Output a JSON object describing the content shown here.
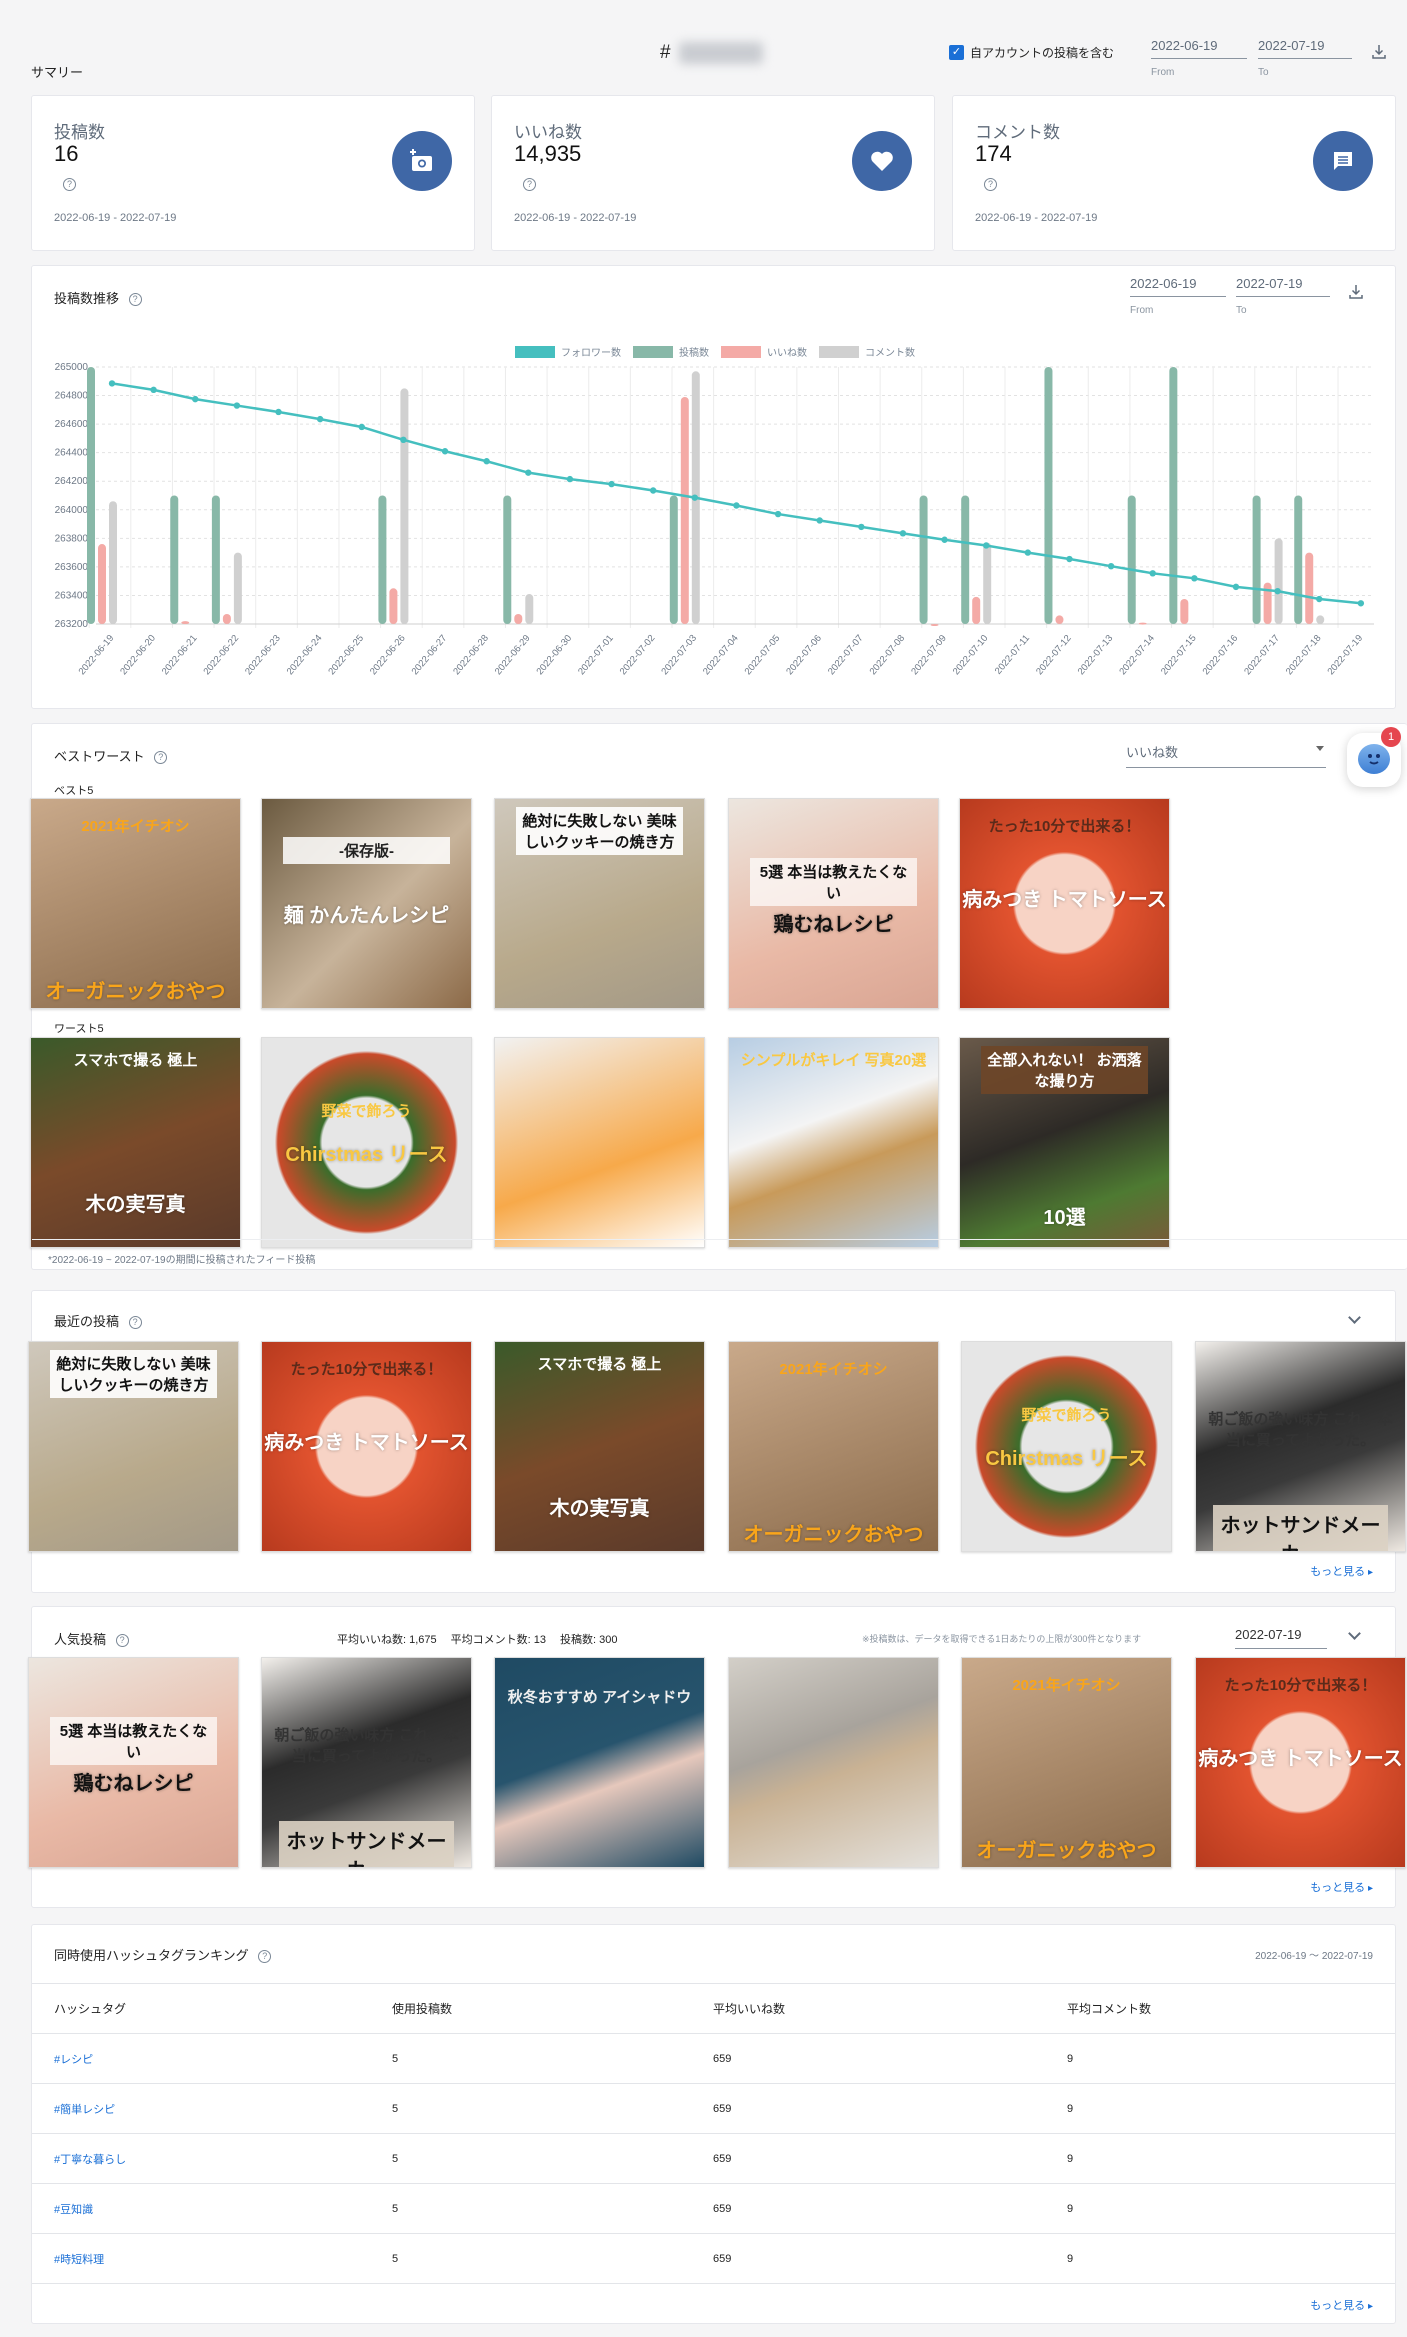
{
  "header": {
    "summary_label": "サマリー",
    "hashtag_prefix": "#",
    "include_own_label": "自アカウントの投稿を含む",
    "include_own_checked": true,
    "from_date": "2022-06-19",
    "to_date": "2022-07-19",
    "from_label": "From",
    "to_label": "To"
  },
  "stats": [
    {
      "title": "投稿数",
      "value": "16",
      "range": "2022-06-19 - 2022-07-19",
      "icon": "add-photo-icon"
    },
    {
      "title": "いいね数",
      "value": "14,935",
      "range": "2022-06-19 - 2022-07-19",
      "icon": "heart-icon"
    },
    {
      "title": "コメント数",
      "value": "174",
      "range": "2022-06-19 - 2022-07-19",
      "icon": "comment-icon"
    }
  ],
  "chart_section": {
    "title": "投稿数推移",
    "from_date": "2022-06-19",
    "to_date": "2022-07-19",
    "from_label": "From",
    "to_label": "To"
  },
  "chart_data": {
    "type": "bar",
    "title": "投稿数推移",
    "xlabel": "",
    "ylabel": "",
    "ylim": [
      263200,
      265000
    ],
    "yticks": [
      265000,
      264800,
      264600,
      264400,
      264200,
      264000,
      263800,
      263600,
      263400,
      263200
    ],
    "grid": true,
    "legend_position": "top-center",
    "categories": [
      "2022-06-19",
      "2022-06-20",
      "2022-06-21",
      "2022-06-22",
      "2022-06-23",
      "2022-06-24",
      "2022-06-25",
      "2022-06-26",
      "2022-06-27",
      "2022-06-28",
      "2022-06-29",
      "2022-06-30",
      "2022-07-01",
      "2022-07-02",
      "2022-07-03",
      "2022-07-04",
      "2022-07-05",
      "2022-07-06",
      "2022-07-07",
      "2022-07-08",
      "2022-07-09",
      "2022-07-10",
      "2022-07-11",
      "2022-07-12",
      "2022-07-13",
      "2022-07-14",
      "2022-07-15",
      "2022-07-16",
      "2022-07-17",
      "2022-07-18",
      "2022-07-19"
    ],
    "series": [
      {
        "name": "フォロワー数",
        "kind": "line",
        "color": "#45bfbf",
        "values": [
          264885,
          264840,
          264775,
          264730,
          264685,
          264635,
          264580,
          264490,
          264410,
          264340,
          264260,
          264215,
          264180,
          264135,
          264085,
          264030,
          263970,
          263925,
          263880,
          263835,
          263790,
          263750,
          263700,
          263655,
          263605,
          263555,
          263520,
          263460,
          263430,
          263375,
          263345
        ]
      },
      {
        "name": "投稿数",
        "kind": "bar",
        "color": "#88b8a8",
        "values": [
          265000,
          null,
          264100,
          264100,
          null,
          null,
          null,
          264100,
          null,
          null,
          264100,
          null,
          null,
          null,
          264100,
          null,
          null,
          null,
          null,
          null,
          264100,
          264100,
          null,
          265000,
          null,
          264100,
          265000,
          null,
          264100,
          264100,
          null
        ]
      },
      {
        "name": "いいね数",
        "kind": "bar",
        "color": "#f4aaa6",
        "values": [
          263760,
          null,
          263220,
          263270,
          null,
          null,
          null,
          263450,
          null,
          null,
          263270,
          null,
          null,
          null,
          264790,
          null,
          null,
          null,
          null,
          null,
          263200,
          263390,
          null,
          263260,
          null,
          263210,
          263375,
          null,
          263490,
          263700,
          null
        ]
      },
      {
        "name": "コメント数",
        "kind": "bar",
        "color": "#d0d0d0",
        "values": [
          264060,
          null,
          null,
          263700,
          null,
          null,
          null,
          264850,
          null,
          null,
          263410,
          null,
          null,
          null,
          264970,
          null,
          null,
          null,
          null,
          null,
          null,
          263770,
          null,
          null,
          null,
          null,
          null,
          null,
          263800,
          263260,
          null
        ]
      }
    ]
  },
  "best_worst": {
    "title": "ベストワースト",
    "metric_select": "いいね数",
    "best_label": "ベスト5",
    "worst_label": "ワースト5",
    "footnote": "*2022-06-19 ~ 2022-07-19の期間に投稿されたフィード投稿",
    "best": [
      {
        "caption": "2021年イチオシ",
        "sub": "オーガニックおやつ",
        "theme": "puffs"
      },
      {
        "caption": "-保存版-",
        "sub": "麺 かんたんレシピ",
        "theme": "noodle"
      },
      {
        "caption": "絶対に失敗しない 美味しいクッキーの焼き方",
        "sub": "",
        "theme": "cookie"
      },
      {
        "caption": "5選 本当は教えたくない",
        "sub": "鶏むねレシピ",
        "theme": "chicken"
      },
      {
        "caption": "たった10分で出来る！",
        "sub": "病みつき トマトソース",
        "theme": "tomato"
      }
    ],
    "worst": [
      {
        "caption": "スマホで撮る 極上",
        "sub": "木の実写真",
        "theme": "nuts"
      },
      {
        "caption": "野菜で飾ろう",
        "sub": "Chirstmas リース",
        "theme": "wreath"
      },
      {
        "caption": "",
        "sub": "",
        "theme": "phone-food"
      },
      {
        "caption": "シンプルがキレイ 写真20選",
        "sub": "",
        "theme": "roast"
      },
      {
        "caption": "全部入れない！ お洒落な撮り方",
        "sub": "10選",
        "theme": "burger"
      }
    ]
  },
  "recent": {
    "title": "最近の投稿",
    "more_label": "もっと見る",
    "posts": [
      {
        "caption": "絶対に失敗しない 美味しいクッキーの焼き方",
        "sub": "",
        "theme": "cookie"
      },
      {
        "caption": "たった10分で出来る！",
        "sub": "病みつき トマトソース",
        "theme": "tomato"
      },
      {
        "caption": "スマホで撮る 極上",
        "sub": "木の実写真",
        "theme": "nuts"
      },
      {
        "caption": "2021年イチオシ",
        "sub": "オーガニックおやつ",
        "theme": "puffs"
      },
      {
        "caption": "野菜で飾ろう",
        "sub": "Chirstmas リース",
        "theme": "wreath"
      },
      {
        "caption": "朝ご飯の強い味方 これ、本当に買ってよかった。",
        "sub": "ホットサンドメーカー",
        "theme": "hotsand"
      }
    ]
  },
  "popular": {
    "title": "人気投稿",
    "avg_likes": "平均いいね数: 1,675",
    "avg_comments": "平均コメント数: 13",
    "post_count": "投稿数: 300",
    "note": "※投稿数は、データを取得できる1日あたりの上限が300件となります",
    "date": "2022-07-19",
    "more_label": "もっと見る",
    "posts": [
      {
        "caption": "5選 本当は教えたくない",
        "sub": "鶏むねレシピ",
        "theme": "chicken"
      },
      {
        "caption": "朝ご飯の強い味方 これ、本当に買ってよかった。",
        "sub": "ホットサンドメーカー",
        "theme": "hotsand"
      },
      {
        "caption": "秋冬おすすめ アイシャドウ",
        "sub": "",
        "theme": "eyeshadow"
      },
      {
        "caption": "",
        "sub": "",
        "theme": "cosmetic"
      },
      {
        "caption": "2021年イチオシ",
        "sub": "オーガニックおやつ",
        "theme": "puffs"
      },
      {
        "caption": "たった10分で出来る！",
        "sub": "病みつき トマトソース",
        "theme": "tomato"
      }
    ]
  },
  "ranking": {
    "title": "同時使用ハッシュタグランキング",
    "range": "2022-06-19 ～ 2022-07-19",
    "columns": [
      "ハッシュタグ",
      "使用投稿数",
      "平均いいね数",
      "平均コメント数"
    ],
    "rows": [
      [
        "#レシピ",
        "5",
        "659",
        "9"
      ],
      [
        "#簡単レシピ",
        "5",
        "659",
        "9"
      ],
      [
        "#丁寧な暮らし",
        "5",
        "659",
        "9"
      ],
      [
        "#豆知識",
        "5",
        "659",
        "9"
      ],
      [
        "#時短料理",
        "5",
        "659",
        "9"
      ]
    ],
    "more_label": "もっと見る"
  },
  "chat_widget": {
    "badge": "1"
  }
}
